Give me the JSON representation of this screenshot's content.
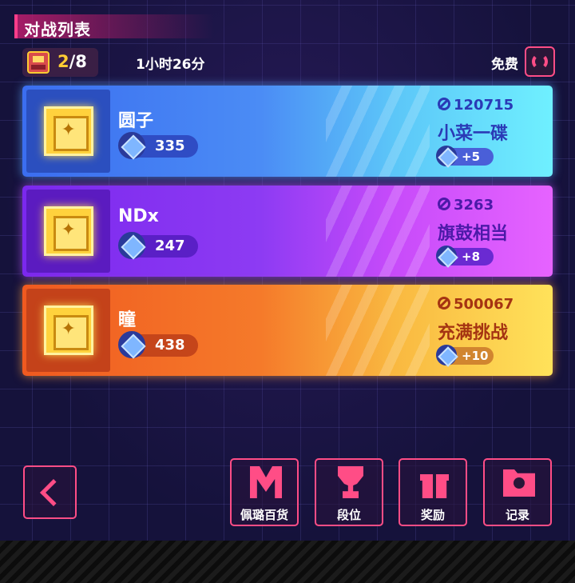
{
  "header": {
    "title": "对战列表",
    "tickets_current": "2",
    "tickets_total": "/8",
    "timer": "1小时26分",
    "free_label": "免费"
  },
  "opponents": [
    {
      "name": "圆子",
      "score": "335",
      "power": "120715",
      "difficulty": "小菜一碟",
      "reward": "+5",
      "theme": "blue"
    },
    {
      "name": "NDx",
      "score": "247",
      "power": "3263",
      "difficulty": "旗鼓相当",
      "reward": "+8",
      "theme": "purple"
    },
    {
      "name": "瞳",
      "score": "438",
      "power": "500067",
      "difficulty": "充满挑战",
      "reward": "+10",
      "theme": "orange"
    }
  ],
  "nav": {
    "shop_label": "佩璐百货",
    "rank_label": "段位",
    "reward_label": "奖励",
    "record_label": "记录"
  },
  "colors": {
    "accent": "#ff4d86",
    "blue_card": "#4b8cf5",
    "purple_card": "#8d3bf3",
    "orange_card": "#f57a2a"
  },
  "icons": [
    "ticket-icon",
    "refresh-icon",
    "emblem-icon",
    "gem-icon",
    "power-icon",
    "back-chevron-icon",
    "shop-icon",
    "trophy-icon",
    "gift-icon",
    "record-icon"
  ]
}
